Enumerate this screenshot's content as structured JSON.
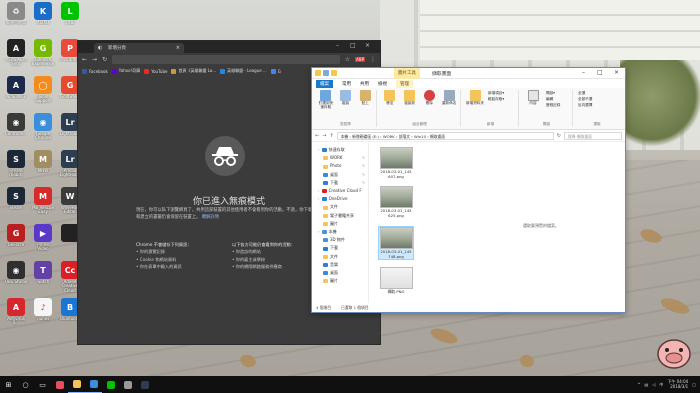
{
  "desktop": {
    "icons": [
      {
        "label": "資源回收筒",
        "color": "#8a8a8a",
        "glyph": "♻"
      },
      {
        "label": "XSIXO",
        "color": "#1a6ec8",
        "glyph": "K"
      },
      {
        "label": "LINE",
        "color": "#00c300",
        "glyph": "L"
      },
      {
        "label": "ASUS Aura\nSync",
        "color": "#222",
        "glyph": "A"
      },
      {
        "label": "GeForce\nExperience",
        "color": "#76b900",
        "glyph": "G"
      },
      {
        "label": "PicCaptur",
        "color": "#e84a3b",
        "glyph": "P"
      },
      {
        "label": "AI Suite 3",
        "color": "#1b2a4a",
        "glyph": "A"
      },
      {
        "label": "Tools\nSupport",
        "color": "#f28c1e",
        "glyph": "◯"
      },
      {
        "label": "Goldwave",
        "color": "#e64a2e",
        "glyph": "G"
      },
      {
        "label": "Controlle...",
        "color": "#3a3a3a",
        "glyph": "◉"
      },
      {
        "label": "Google\nChrome",
        "color": "#3a8fdc",
        "glyph": "◉"
      },
      {
        "label": "Lightroom",
        "color": "#2c3e50",
        "glyph": "Lr"
      },
      {
        "label": "Steam\n(64bit)",
        "color": "#1b2838",
        "glyph": "S"
      },
      {
        "label": "MHW",
        "color": "#a08d62",
        "glyph": "M"
      },
      {
        "label": "Adobe\nLightroo...",
        "color": "#2c3e50",
        "glyph": "Lr"
      },
      {
        "label": "Steam",
        "color": "#1b2838",
        "glyph": "S"
      },
      {
        "label": "MB Rescue\nEasy",
        "color": "#d62b2b",
        "glyph": "M"
      },
      {
        "label": "WavePad\nEditor",
        "color": "#3b3b3b",
        "glyph": "W"
      },
      {
        "label": "GeForce",
        "color": "#b91f1f",
        "glyph": "G"
      },
      {
        "label": "Prime\nVideo",
        "color": "#5a38c8",
        "glyph": "▶"
      },
      {
        "label": "",
        "color": "#222",
        "glyph": ""
      },
      {
        "label": "OBS Studio",
        "color": "#302e31",
        "glyph": "◉"
      },
      {
        "label": "Twitch",
        "color": "#6441a5",
        "glyph": "T"
      },
      {
        "label": "Adobe\nCreative\nCloud",
        "color": "#da1f26",
        "glyph": "Cc"
      },
      {
        "label": "Antivirus\nS...",
        "color": "#d8262e",
        "glyph": "A"
      },
      {
        "label": "iTunes",
        "color": "#f5f5f5",
        "glyph": "♪"
      },
      {
        "label": "Bluetooth",
        "color": "#1976d2",
        "glyph": "B"
      }
    ]
  },
  "chrome": {
    "tab_title": "新增分頁",
    "close_glyph": "×",
    "omnibox": "",
    "bookmarks": [
      {
        "label": "Facebook",
        "color": "#3b5998"
      },
      {
        "label": "Yahoo!奇摩",
        "color": "#5f01d1"
      },
      {
        "label": "YouTube",
        "color": "#e52d27"
      },
      {
        "label": "首頁《英雄聯盟 Lo...",
        "color": "#c89b3c"
      },
      {
        "label": "英雄聯盟 - League ...",
        "color": "#1e88e5"
      },
      {
        "label": "G",
        "color": "#4285f4"
      }
    ],
    "incognito": {
      "title": "你已進入無痕模式",
      "desc_a": "現在，你可以私下瀏覽網頁了，共用這部裝置的其他使用者不會看到你的活動。不過，你下載的內容和建立的書籤仍會保留在裝置上。",
      "desc_link": "瞭解詳情",
      "col1": {
        "heading": "Chrome 不會儲存下列資訊：",
        "items": [
          "你的瀏覽記錄",
          "Cookie 和網站資料",
          "你在表單中輸入的資訊"
        ]
      },
      "col2": {
        "heading": "以下各方可能仍會看到你的活動：",
        "items": [
          "你造訪的網站",
          "你的雇主或學校",
          "你的網際網路服務供應商"
        ]
      }
    }
  },
  "explorer": {
    "context_tab": "圖片工具",
    "window_title": "擷取畫面",
    "tabs": [
      "檔案",
      "常用",
      "共用",
      "檢視",
      "管理"
    ],
    "ribbon_groups": [
      {
        "label": "剪貼簿",
        "buttons": [
          "釘選到快速存取",
          "複製",
          "貼上"
        ]
      },
      {
        "label": "組合管理",
        "buttons": [
          "移至",
          "複製到",
          "刪除",
          "重新命名"
        ]
      },
      {
        "label": "新增",
        "buttons": [
          "新增資料夾"
        ]
      },
      {
        "label": "開啟",
        "buttons": [
          "內容"
        ]
      },
      {
        "label": "選取",
        "buttons": [
          "全選",
          "全部不選",
          "反向選擇"
        ]
      }
    ],
    "ribbon_small": [
      "新增項目▾",
      "輕鬆存取▾",
      "開啟▾",
      "編輯",
      "歷程記錄"
    ],
    "path": "本機 › 新增磁碟區 (E:) › WORK › 部落文 › Win10 › 擷取畫面",
    "search_placeholder": "搜尋 擷取畫面",
    "nav": [
      {
        "label": "快速存取",
        "level": 0,
        "color": "#2f7cd3",
        "pin": false
      },
      {
        "label": "WORK",
        "level": 1,
        "color": "#f2c45a",
        "pin": true
      },
      {
        "label": "Photo",
        "level": 1,
        "color": "#f2c45a",
        "pin": true
      },
      {
        "label": "桌面",
        "level": 1,
        "color": "#3b8ad8",
        "pin": true
      },
      {
        "label": "下載",
        "level": 1,
        "color": "#2f7cd3",
        "pin": true
      },
      {
        "label": "Creative Cloud F",
        "level": 0,
        "color": "#da1f26",
        "pin": false
      },
      {
        "label": "OneDrive",
        "level": 0,
        "color": "#2f7cd3",
        "pin": false
      },
      {
        "label": "文件",
        "level": 1,
        "color": "#f2c45a",
        "pin": false
      },
      {
        "label": "電子書籍共享",
        "level": 1,
        "color": "#f2c45a",
        "pin": false
      },
      {
        "label": "圖片",
        "level": 1,
        "color": "#f2c45a",
        "pin": false
      },
      {
        "label": "本機",
        "level": 0,
        "color": "#4c8fd6",
        "pin": false
      },
      {
        "label": "3D 物件",
        "level": 1,
        "color": "#4c8fd6",
        "pin": false
      },
      {
        "label": "下載",
        "level": 1,
        "color": "#2f7cd3",
        "pin": false
      },
      {
        "label": "文件",
        "level": 1,
        "color": "#f2c45a",
        "pin": false
      },
      {
        "label": "音樂",
        "level": 1,
        "color": "#2f7cd3",
        "pin": false
      },
      {
        "label": "桌面",
        "level": 1,
        "color": "#3b8ad8",
        "pin": false
      },
      {
        "label": "圖片",
        "level": 1,
        "color": "#f2c45a",
        "pin": false
      }
    ],
    "files": [
      {
        "name": "2018-03-01_145\n607.png",
        "selected": false
      },
      {
        "name": "2018-03-01_145\n625.png",
        "selected": false
      },
      {
        "name": "2018-03-01_145\n748.png",
        "selected": true
      },
      {
        "name": "擷取.PNG",
        "selected": false
      }
    ],
    "preview_message": "選取要預覽的檔案。",
    "status": {
      "items": "4 個項目",
      "selected": "已選取 1 個項目"
    }
  },
  "taskbar": {
    "start_glyph": "⊞",
    "items": [
      {
        "name": "search",
        "glyph": "○"
      },
      {
        "name": "task-view",
        "glyph": "▭"
      },
      {
        "name": "store",
        "color": "#e84d60"
      },
      {
        "name": "file-explorer",
        "color": "#f2c45a"
      },
      {
        "name": "chrome",
        "color": "#3a8fdc"
      },
      {
        "name": "line",
        "color": "#00c300"
      },
      {
        "name": "app7",
        "color": "#9a9a9a"
      },
      {
        "name": "lightroom",
        "color": "#2c3e50"
      }
    ],
    "clock_time": "下午 04:04",
    "clock_date": "2018/3/1"
  }
}
